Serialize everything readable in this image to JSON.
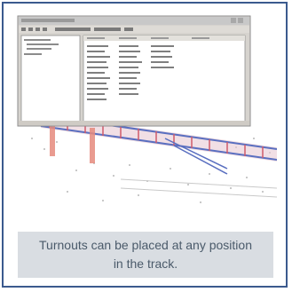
{
  "caption": "Turnouts can be placed at any position in the track."
}
